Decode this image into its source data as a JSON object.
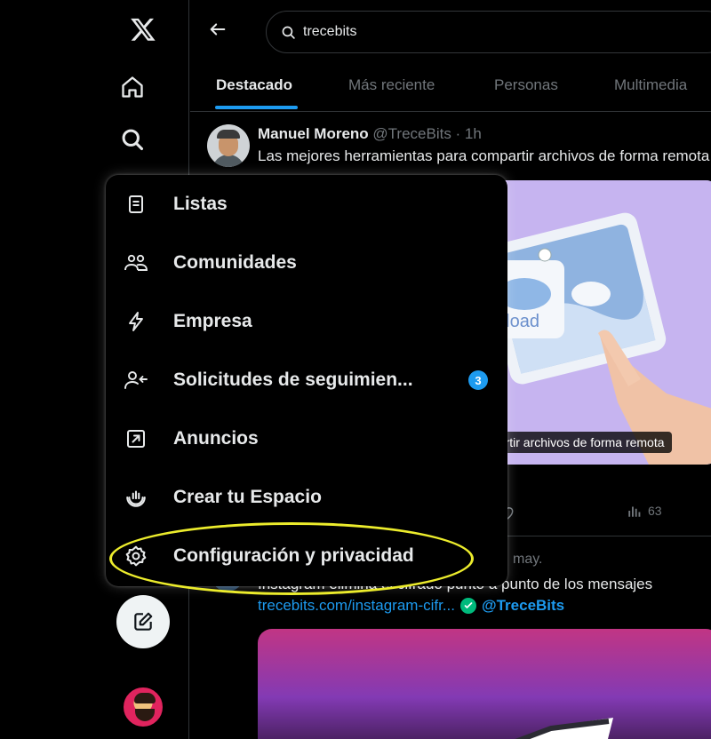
{
  "search": {
    "query": "trecebits"
  },
  "tabs": [
    "Destacado",
    "Más reciente",
    "Personas",
    "Multimedia"
  ],
  "tweet1": {
    "name": "Manuel Moreno",
    "handle_time": "@TreceBits · 1h",
    "text": "Las mejores herramientas para compartir archivos de forma remota",
    "media_caption": "partir archivos de forma remota",
    "media_upload_text": "pload",
    "views": "63"
  },
  "tweet2": {
    "meta": "may.",
    "text": "Instagram elimina el cifrado punto a punto de los mensajes",
    "link": "trecebits.com/instagram-cifr...",
    "handle": "@TreceBits"
  },
  "menu": {
    "items": [
      {
        "label": "Listas",
        "icon": "list-icon"
      },
      {
        "label": "Comunidades",
        "icon": "communities-icon"
      },
      {
        "label": "Empresa",
        "icon": "lightning-icon"
      },
      {
        "label": "Solicitudes de seguimien...",
        "icon": "follow-request-icon",
        "badge": "3"
      },
      {
        "label": "Anuncios",
        "icon": "ads-icon"
      },
      {
        "label": "Crear tu Espacio",
        "icon": "spaces-icon"
      },
      {
        "label": "Configuración y privacidad",
        "icon": "gear-icon"
      }
    ]
  },
  "colors": {
    "accent": "#1d9bf0",
    "highlight": "#ecec2c",
    "background": "#000000"
  }
}
